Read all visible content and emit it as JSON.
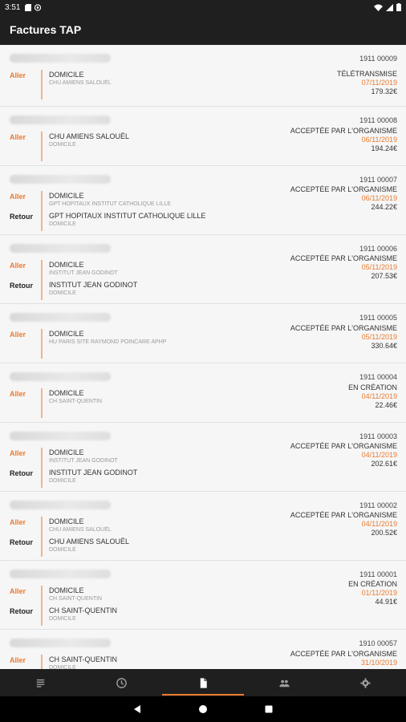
{
  "status_bar": {
    "time": "3:51"
  },
  "app_bar": {
    "title": "Factures TAP"
  },
  "invoices": [
    {
      "number": "1911 00009",
      "status": "TÉLÉTRANSMISE",
      "date": "07/11/2019",
      "amount": "179.32€",
      "legs": [
        {
          "label": "Aller",
          "lines": [
            {
              "text": "DOMICILE",
              "style": "main"
            },
            {
              "text": "CHU AMIENS SALOUËL",
              "style": "sub"
            }
          ]
        }
      ]
    },
    {
      "number": "1911 00008",
      "status": "ACCEPTÉE PAR L'ORGANISME",
      "date": "06/11/2019",
      "amount": "194.24€",
      "legs": [
        {
          "label": "Aller",
          "lines": [
            {
              "text": "CHU AMIENS SALOUËL",
              "style": "main"
            },
            {
              "text": "DOMICILE",
              "style": "sub"
            }
          ]
        }
      ]
    },
    {
      "number": "1911 00007",
      "status": "ACCEPTÉE PAR L'ORGANISME",
      "date": "06/11/2019",
      "amount": "244.22€",
      "legs": [
        {
          "label": "Aller",
          "lines": [
            {
              "text": "DOMICILE",
              "style": "main"
            },
            {
              "text": "GPT HOPITAUX INSTITUT CATHOLIQUE LILLE",
              "style": "sub"
            }
          ]
        },
        {
          "label": "Retour",
          "lines": [
            {
              "text": "GPT HOPITAUX INSTITUT CATHOLIQUE LILLE",
              "style": "main"
            },
            {
              "text": "DOMICILE",
              "style": "sub"
            }
          ]
        }
      ]
    },
    {
      "number": "1911 00006",
      "status": "ACCEPTÉE PAR L'ORGANISME",
      "date": "05/11/2019",
      "amount": "207.53€",
      "legs": [
        {
          "label": "Aller",
          "lines": [
            {
              "text": "DOMICILE",
              "style": "main"
            },
            {
              "text": "INSTITUT JEAN GODINOT",
              "style": "sub"
            }
          ]
        },
        {
          "label": "Retour",
          "lines": [
            {
              "text": "INSTITUT JEAN GODINOT",
              "style": "main"
            },
            {
              "text": "DOMICILE",
              "style": "sub"
            }
          ]
        }
      ]
    },
    {
      "number": "1911 00005",
      "status": "ACCEPTÉE PAR L'ORGANISME",
      "date": "05/11/2019",
      "amount": "330.64€",
      "legs": [
        {
          "label": "Aller",
          "lines": [
            {
              "text": "DOMICILE",
              "style": "main"
            },
            {
              "text": "HU PARIS SITE RAYMOND POINCARE APHP",
              "style": "sub"
            }
          ]
        }
      ]
    },
    {
      "number": "1911 00004",
      "status": "EN CRÉATION",
      "date": "04/11/2019",
      "amount": "22.46€",
      "legs": [
        {
          "label": "Aller",
          "lines": [
            {
              "text": "DOMICILE",
              "style": "main"
            },
            {
              "text": "CH SAINT-QUENTIN",
              "style": "sub"
            }
          ]
        }
      ]
    },
    {
      "number": "1911 00003",
      "status": "ACCEPTÉE PAR L'ORGANISME",
      "date": "04/11/2019",
      "amount": "202.61€",
      "legs": [
        {
          "label": "Aller",
          "lines": [
            {
              "text": "DOMICILE",
              "style": "main"
            },
            {
              "text": "INSTITUT JEAN GODINOT",
              "style": "sub"
            }
          ]
        },
        {
          "label": "Retour",
          "lines": [
            {
              "text": "INSTITUT JEAN GODINOT",
              "style": "main"
            },
            {
              "text": "DOMICILE",
              "style": "sub"
            }
          ]
        }
      ]
    },
    {
      "number": "1911 00002",
      "status": "ACCEPTÉE PAR L'ORGANISME",
      "date": "04/11/2019",
      "amount": "200.52€",
      "legs": [
        {
          "label": "Aller",
          "lines": [
            {
              "text": "DOMICILE",
              "style": "main"
            },
            {
              "text": "CHU AMIENS SALOUËL",
              "style": "sub"
            }
          ]
        },
        {
          "label": "Retour",
          "lines": [
            {
              "text": "CHU AMIENS SALOUËL",
              "style": "main"
            },
            {
              "text": "DOMICILE",
              "style": "sub"
            }
          ]
        }
      ]
    },
    {
      "number": "1911 00001",
      "status": "EN CRÉATION",
      "date": "01/11/2019",
      "amount": "44.91€",
      "legs": [
        {
          "label": "Aller",
          "lines": [
            {
              "text": "DOMICILE",
              "style": "main"
            },
            {
              "text": "CH SAINT-QUENTIN",
              "style": "sub"
            }
          ]
        },
        {
          "label": "Retour",
          "lines": [
            {
              "text": "CH SAINT-QUENTIN",
              "style": "main"
            },
            {
              "text": "DOMICILE",
              "style": "sub"
            }
          ]
        }
      ]
    },
    {
      "number": "1910 00057",
      "status": "ACCEPTÉE PAR L'ORGANISME",
      "date": "31/10/2019",
      "amount": "",
      "legs": [
        {
          "label": "Aller",
          "lines": [
            {
              "text": "CH SAINT-QUENTIN",
              "style": "main"
            },
            {
              "text": "DOMICILE",
              "style": "sub"
            }
          ]
        }
      ]
    }
  ],
  "bottom_nav": [
    {
      "icon": "list-icon",
      "active": false
    },
    {
      "icon": "history-clock-icon",
      "active": false
    },
    {
      "icon": "invoice-document-icon",
      "active": true
    },
    {
      "icon": "patients-people-icon",
      "active": false
    },
    {
      "icon": "settings-gear-icon",
      "active": false
    }
  ],
  "colors": {
    "accent": "#e97b30",
    "bar": "#1f1f1f",
    "background": "#f3f3f3"
  }
}
